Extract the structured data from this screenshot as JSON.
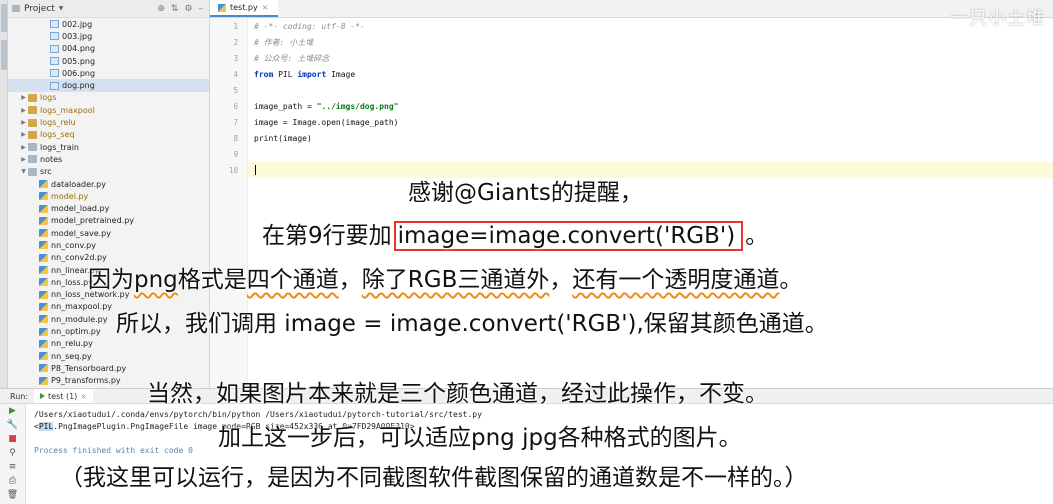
{
  "project_panel": {
    "title": "Project",
    "tree": [
      {
        "label": "002.jpg",
        "kind": "img",
        "depth": 3
      },
      {
        "label": "003.jpg",
        "kind": "img",
        "depth": 3
      },
      {
        "label": "004.png",
        "kind": "img",
        "depth": 3
      },
      {
        "label": "005.png",
        "kind": "img",
        "depth": 3
      },
      {
        "label": "006.png",
        "kind": "img",
        "depth": 3
      },
      {
        "label": "dog.png",
        "kind": "img",
        "depth": 3,
        "selected": true
      },
      {
        "label": "logs",
        "kind": "folder",
        "depth": 1,
        "color": "orange",
        "collapsed": true
      },
      {
        "label": "logs_maxpool",
        "kind": "folder",
        "depth": 1,
        "color": "orange",
        "collapsed": true
      },
      {
        "label": "logs_relu",
        "kind": "folder",
        "depth": 1,
        "color": "orange",
        "collapsed": true
      },
      {
        "label": "logs_seq",
        "kind": "folder",
        "depth": 1,
        "color": "orange",
        "collapsed": true
      },
      {
        "label": "logs_train",
        "kind": "folder",
        "depth": 1,
        "collapsed": true
      },
      {
        "label": "notes",
        "kind": "folder",
        "depth": 1,
        "collapsed": true
      },
      {
        "label": "src",
        "kind": "folder",
        "depth": 1,
        "expanded": true
      },
      {
        "label": "dataloader.py",
        "kind": "py",
        "depth": 2
      },
      {
        "label": "model.py",
        "kind": "py",
        "depth": 2,
        "color": "orange"
      },
      {
        "label": "model_load.py",
        "kind": "py",
        "depth": 2
      },
      {
        "label": "model_pretrained.py",
        "kind": "py",
        "depth": 2
      },
      {
        "label": "model_save.py",
        "kind": "py",
        "depth": 2
      },
      {
        "label": "nn_conv.py",
        "kind": "py",
        "depth": 2
      },
      {
        "label": "nn_conv2d.py",
        "kind": "py",
        "depth": 2
      },
      {
        "label": "nn_linear.py",
        "kind": "py",
        "depth": 2
      },
      {
        "label": "nn_loss.py",
        "kind": "py",
        "depth": 2
      },
      {
        "label": "nn_loss_network.py",
        "kind": "py",
        "depth": 2
      },
      {
        "label": "nn_maxpool.py",
        "kind": "py",
        "depth": 2
      },
      {
        "label": "nn_module.py",
        "kind": "py",
        "depth": 2
      },
      {
        "label": "nn_optim.py",
        "kind": "py",
        "depth": 2
      },
      {
        "label": "nn_relu.py",
        "kind": "py",
        "depth": 2
      },
      {
        "label": "nn_seq.py",
        "kind": "py",
        "depth": 2
      },
      {
        "label": "P8_Tensorboard.py",
        "kind": "py",
        "depth": 2
      },
      {
        "label": "P9_transforms.py",
        "kind": "py",
        "depth": 2
      }
    ]
  },
  "editor": {
    "tab_label": "test.py",
    "watermark": "一只小土堆",
    "lines": [
      {
        "num": "1",
        "parts": [
          {
            "t": "# -*- coding: utf-8 -*-",
            "c": "comment"
          }
        ]
      },
      {
        "num": "2",
        "parts": [
          {
            "t": "# 作者: 小土堆",
            "c": "comment"
          }
        ]
      },
      {
        "num": "3",
        "parts": [
          {
            "t": "# 公众号: 土堆碎念",
            "c": "comment"
          }
        ]
      },
      {
        "num": "4",
        "parts": [
          {
            "t": "from ",
            "c": "kw"
          },
          {
            "t": "PIL ",
            "c": ""
          },
          {
            "t": "import ",
            "c": "kw"
          },
          {
            "t": "Image",
            "c": ""
          }
        ]
      },
      {
        "num": "5",
        "parts": []
      },
      {
        "num": "6",
        "parts": [
          {
            "t": "image_path = ",
            "c": ""
          },
          {
            "t": "\"../imgs/dog.png\"",
            "c": "str"
          }
        ]
      },
      {
        "num": "7",
        "parts": [
          {
            "t": "image = Image.open(image_path)",
            "c": ""
          }
        ]
      },
      {
        "num": "8",
        "parts": [
          {
            "t": "print(image)",
            "c": ""
          }
        ]
      },
      {
        "num": "9",
        "parts": []
      },
      {
        "num": "10",
        "parts": [],
        "current": true
      }
    ]
  },
  "run_panel": {
    "label": "Run:",
    "tab": "test (1)",
    "output": [
      "/Users/xiaotudui/.conda/envs/pytorch/bin/python /Users/xiaotudui/pytorch-tutorial/src/test.py",
      ".PngImagePlugin.PngImageFile image mode=RGB size=452x336 at 0x7FD29A09E310>",
      "",
      "Process finished with exit code 0"
    ],
    "output_prefix": "<",
    "output_highlight": "PIL"
  },
  "annotations": {
    "line1": "感谢@Giants的提醒，",
    "line2_pre": "在第9行要加",
    "line2_code": "image=image.convert('RGB')",
    "line2_post": "。",
    "line3_a": "因为",
    "line3_b": "png",
    "line3_c": "格式是",
    "line3_d": "四个通道",
    "line3_e": "，",
    "line3_f": "除了RGB三通道外",
    "line3_g": "，",
    "line3_h": "还有一个透明度通道",
    "line3_i": "。",
    "line4": "所以，我们调用 image = image.convert('RGB'),保留其颜色通道。",
    "line5": "当然，如果图片本来就是三个颜色通道，经过此操作，不变。",
    "line6": "加上这一步后，可以适应png jpg各种格式的图片。",
    "line7": "（我这里可以运行，是因为不同截图软件截图保留的通道数是不一样的。）"
  },
  "colors": {
    "accent_red": "#e8322f",
    "underline_orange": "#f08a1c"
  }
}
